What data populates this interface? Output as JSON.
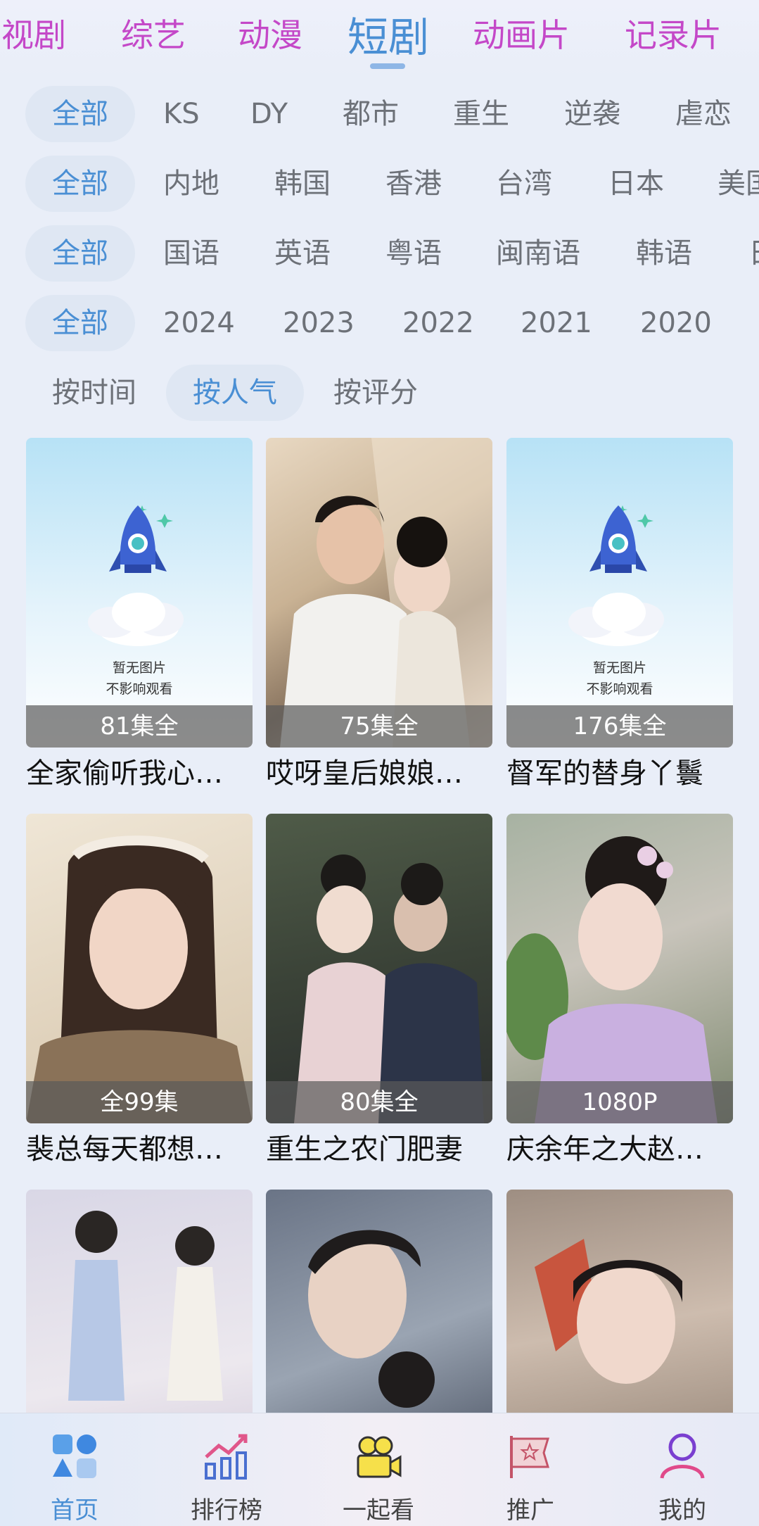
{
  "top_tabs": [
    "视剧",
    "综艺",
    "动漫",
    "短剧",
    "动画片",
    "记录片"
  ],
  "active_top_tab": "短剧",
  "filters": {
    "genre": [
      "全部",
      "KS",
      "DY",
      "都市",
      "重生",
      "逆袭",
      "虐恋"
    ],
    "region": [
      "全部",
      "内地",
      "韩国",
      "香港",
      "台湾",
      "日本",
      "美国"
    ],
    "language": [
      "全部",
      "国语",
      "英语",
      "粤语",
      "闽南语",
      "韩语",
      "日"
    ],
    "year": [
      "全部",
      "2024",
      "2023",
      "2022",
      "2021",
      "2020"
    ],
    "sort": [
      "按时间",
      "按人气",
      "按评分"
    ]
  },
  "placeholder": {
    "line1": "暂无图片",
    "line2": "不影响观看"
  },
  "cards": [
    {
      "badge": "81集全",
      "title": "全家偷听我心…"
    },
    {
      "badge": "75集全",
      "title": "哎呀皇后娘娘…"
    },
    {
      "badge": "176集全",
      "title": "督军的替身丫鬟"
    },
    {
      "badge": "全99集",
      "title": "裴总每天都想…"
    },
    {
      "badge": "80集全",
      "title": "重生之农门肥妻"
    },
    {
      "badge": "1080P",
      "title": "庆余年之大赵…"
    },
    {
      "badge": "",
      "title": ""
    },
    {
      "badge": "",
      "title": ""
    },
    {
      "badge": "",
      "title": ""
    }
  ],
  "bottom_nav": [
    {
      "label": "首页",
      "icon": "home-icon"
    },
    {
      "label": "排行榜",
      "icon": "ranking-chart-icon"
    },
    {
      "label": "一起看",
      "icon": "video-camera-icon"
    },
    {
      "label": "推广",
      "icon": "promotion-flag-icon"
    },
    {
      "label": "我的",
      "icon": "profile-icon"
    }
  ],
  "colors": {
    "accent": "#4a8fd4",
    "top_tab_inactive": "#c448c8",
    "background": "#e9eef8"
  }
}
